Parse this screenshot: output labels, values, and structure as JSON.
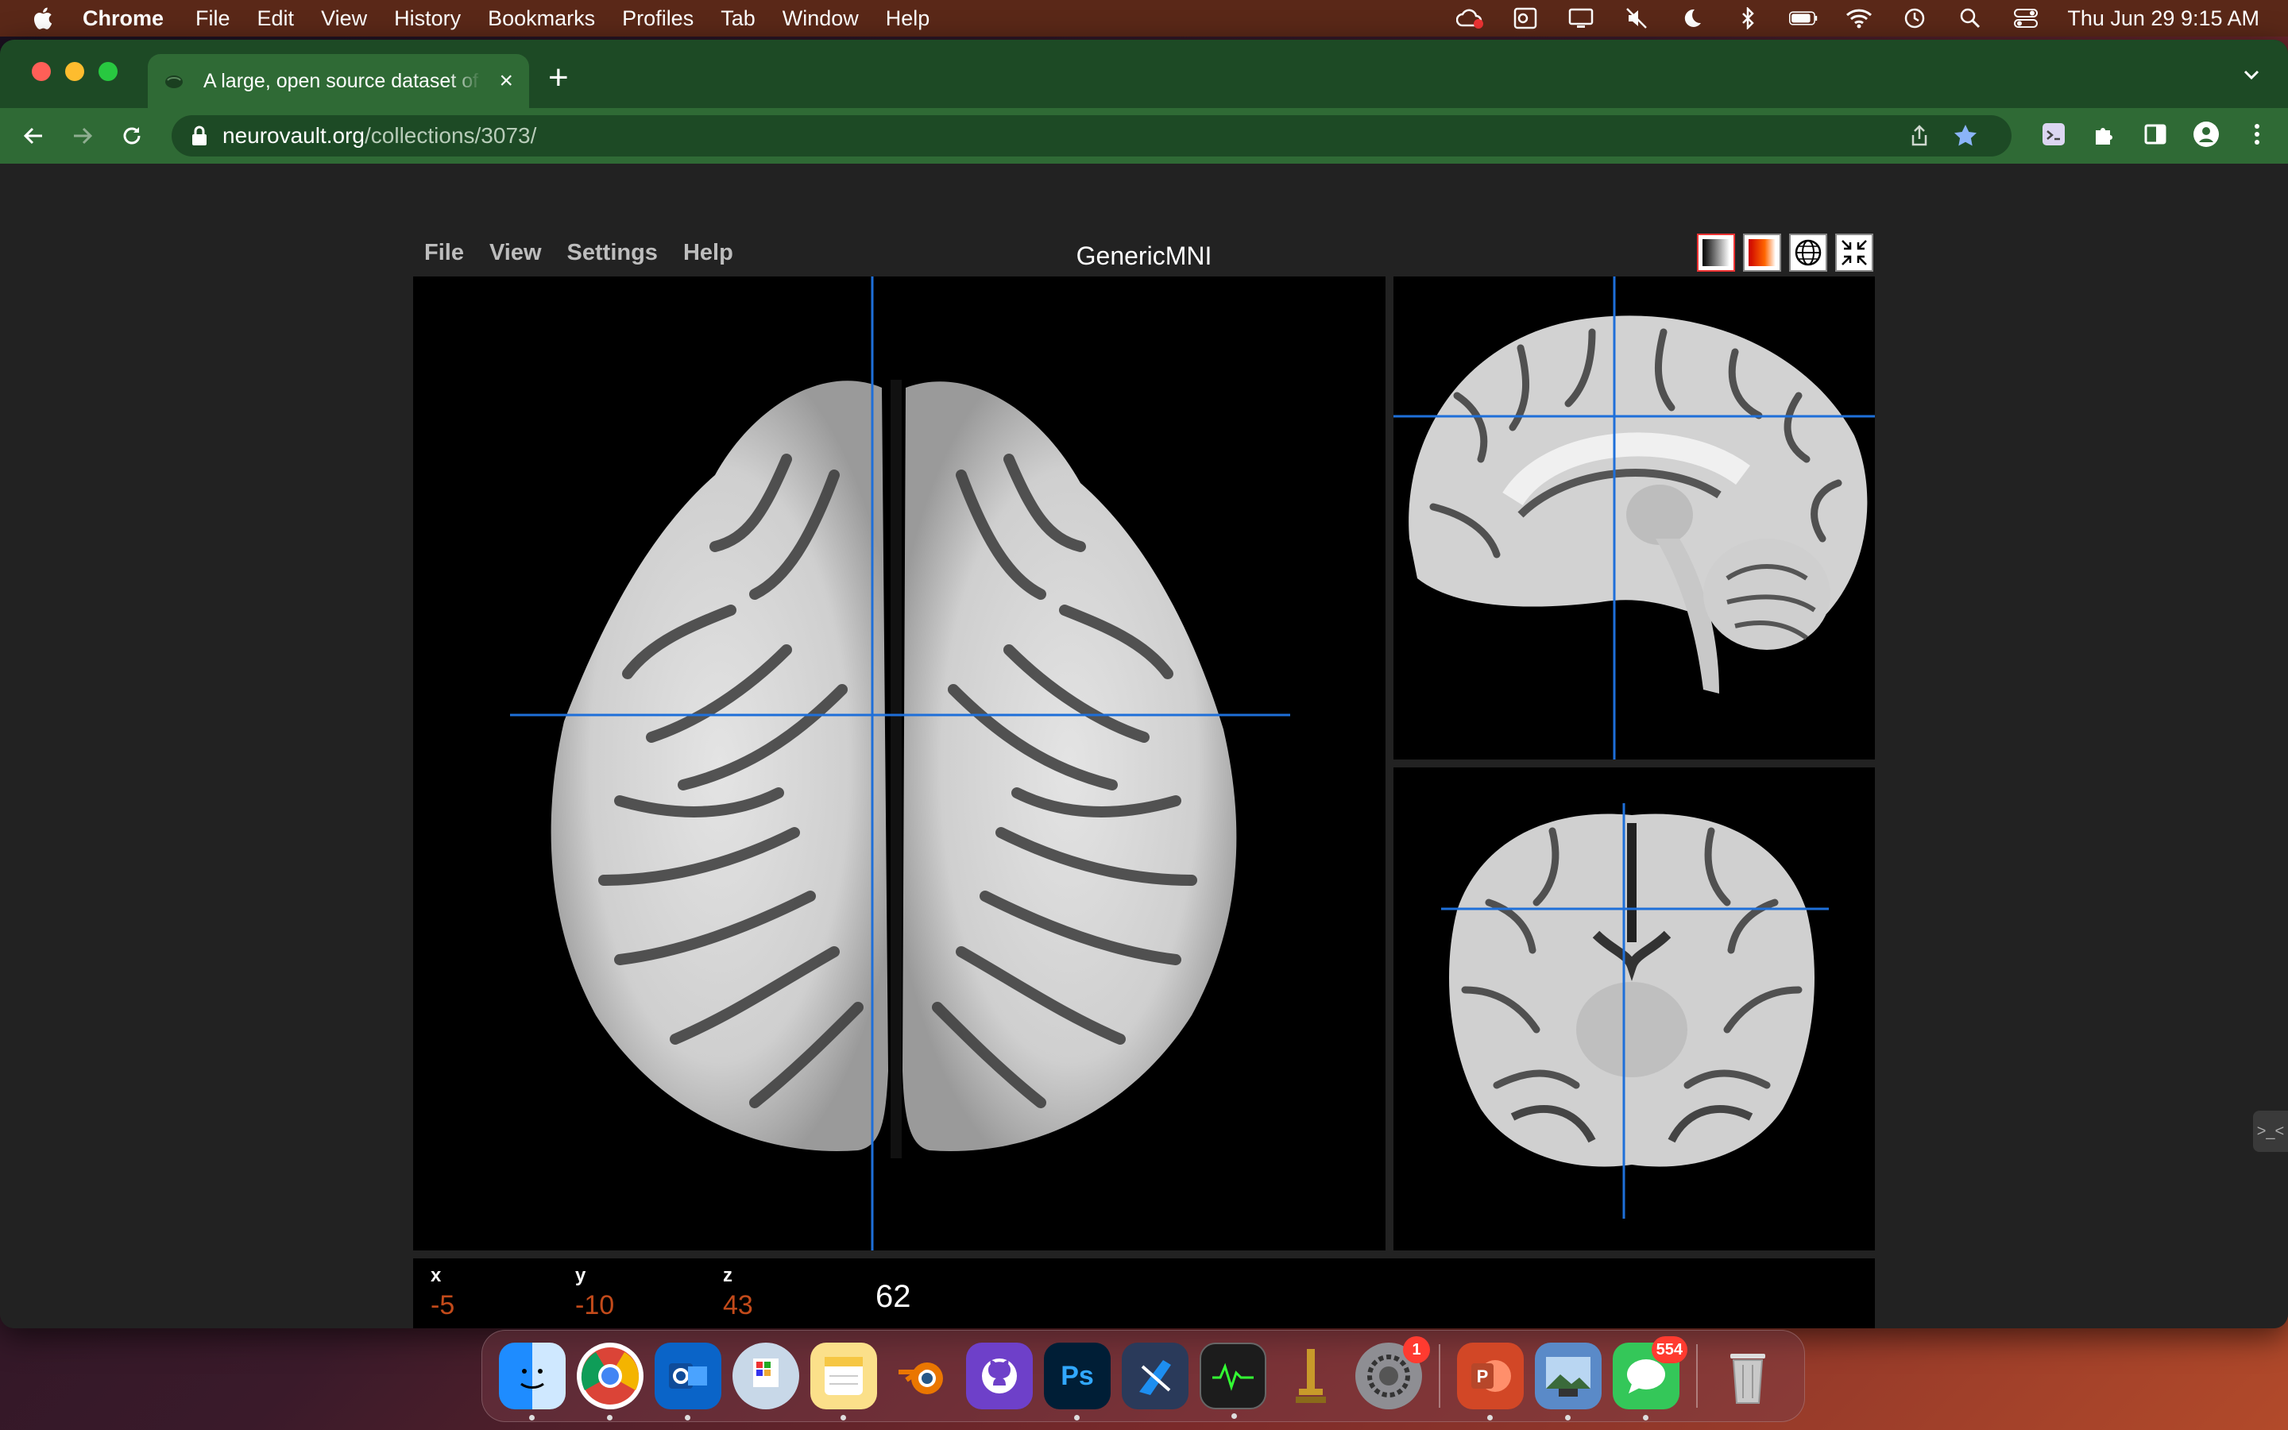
{
  "menubar": {
    "app_name": "Chrome",
    "items": [
      "File",
      "Edit",
      "View",
      "History",
      "Bookmarks",
      "Profiles",
      "Tab",
      "Window",
      "Help"
    ],
    "clock": "Thu Jun 29  9:15 AM",
    "status_icons": [
      "creative-cloud-icon",
      "outlook-icon",
      "display-icon",
      "mute-icon",
      "moon-icon",
      "bluetooth-icon",
      "battery-icon",
      "wifi-icon",
      "time-machine-icon",
      "spotlight-icon",
      "control-center-icon"
    ]
  },
  "browser": {
    "tab_title": "A large, open source dataset of",
    "url_domain": "neurovault.org",
    "url_path": "/collections/3073/"
  },
  "viewer": {
    "menu": [
      "File",
      "View",
      "Settings",
      "Help"
    ],
    "title": "GenericMNI",
    "tools": [
      "grayscale-colormap-icon",
      "hot-colormap-icon",
      "globe-icon",
      "collapse-icon"
    ],
    "coords": {
      "x_label": "x",
      "x_value": "-5",
      "y_label": "y",
      "y_value": "-10",
      "z_label": "z",
      "z_value": "43"
    },
    "intensity": "62",
    "crosshair_color": "#1e6fd9",
    "coord_value_color": "#c24a1a"
  },
  "dock": {
    "apps": [
      "Finder",
      "Chrome",
      "Outlook",
      "Preview",
      "Notes",
      "Blender",
      "GitHub Desktop",
      "Photoshop",
      "Xcode",
      "Activity Monitor",
      "Instruments",
      "System Settings",
      "PowerPoint",
      "Preview Photos",
      "Messages",
      "Trash"
    ],
    "badges": {
      "system_settings": "1",
      "messages": "554"
    }
  }
}
